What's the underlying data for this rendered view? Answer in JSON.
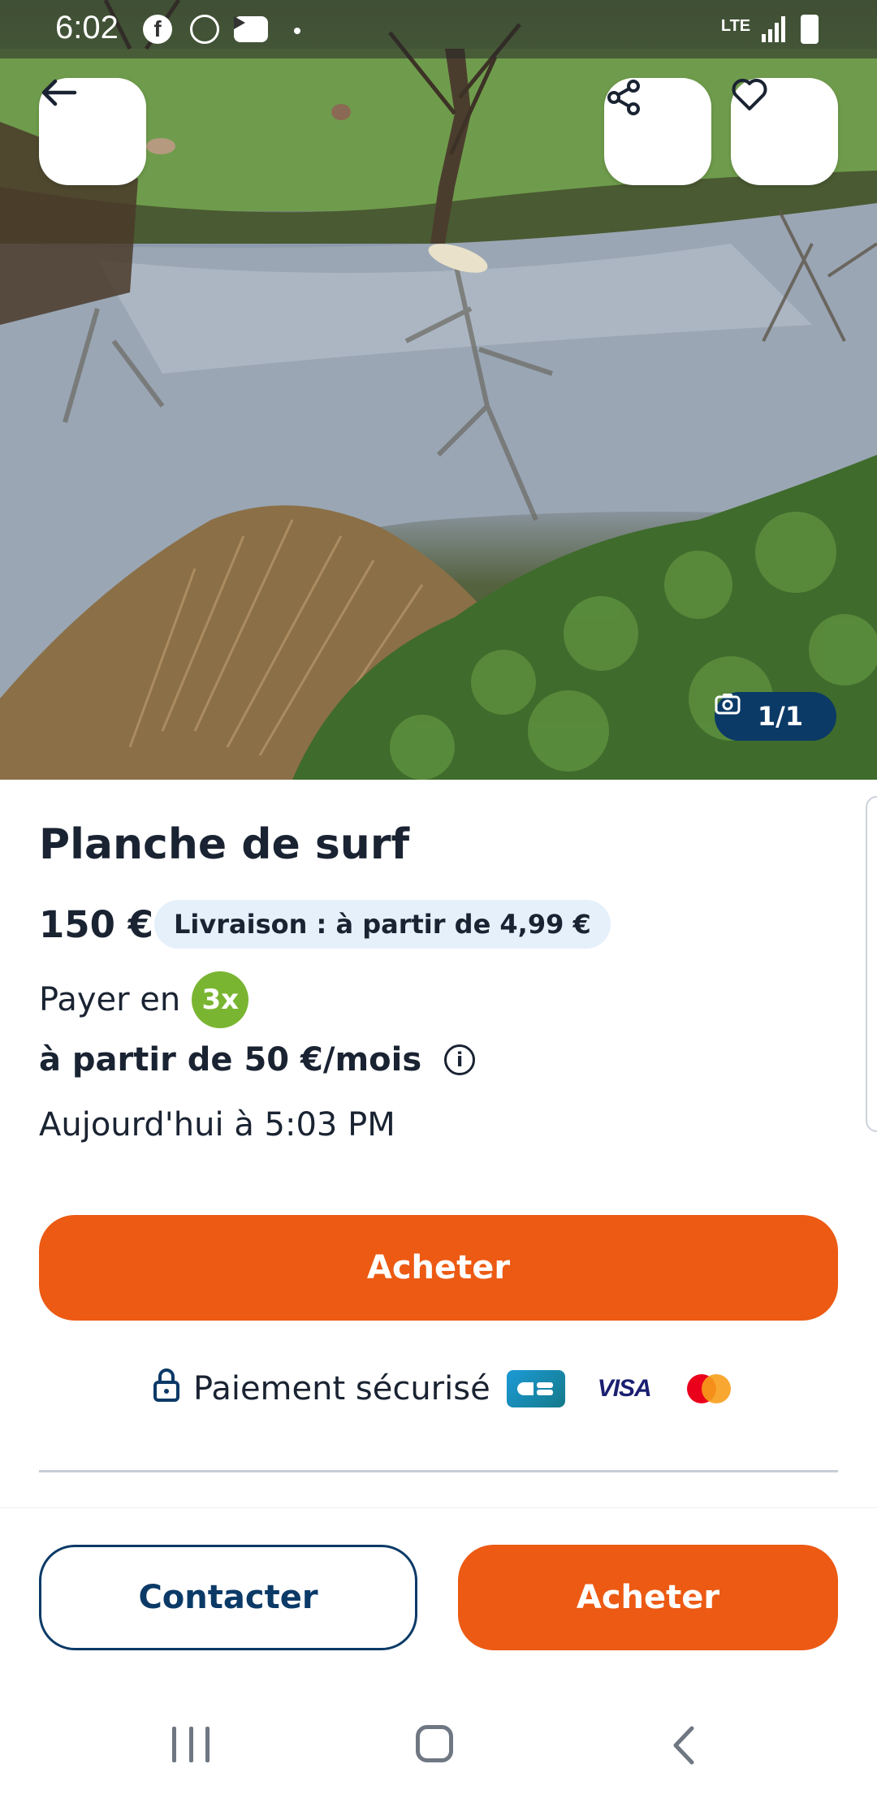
{
  "status_bar": {
    "time": "6:02",
    "network": "LTE",
    "icons": [
      "facebook-icon",
      "mail-icon",
      "youtube-icon",
      "dot-icon",
      "lte-icon",
      "signal-icon",
      "battery-icon"
    ]
  },
  "header": {
    "icons": [
      "arrow-left-icon",
      "share-icon",
      "heart-icon"
    ],
    "photo_counter": "1/1"
  },
  "listing": {
    "title": "Planche de surf",
    "price": "150 €",
    "delivery": "Livraison : à partir de 4,99 €",
    "pay_in": "Payer en",
    "installments_badge": "3x",
    "monthly": "à partir de 50 €/mois",
    "posted": "Aujourd'hui à 5:03 PM"
  },
  "actions": {
    "buy_main": "Acheter",
    "contact": "Contacter",
    "buy_sticky": "Acheter"
  },
  "payment": {
    "label": "Paiement sécurisé",
    "visa": "VISA",
    "methods": [
      "cb-logo",
      "visa-logo",
      "mastercard-logo"
    ]
  },
  "colors": {
    "accent_orange": "#ec5a13",
    "navy": "#0b3a67",
    "delivery_badge_bg": "#e5f0fb",
    "installments_green": "#7ab532"
  },
  "system_nav": [
    "recents-icon",
    "home-icon",
    "back-icon"
  ]
}
